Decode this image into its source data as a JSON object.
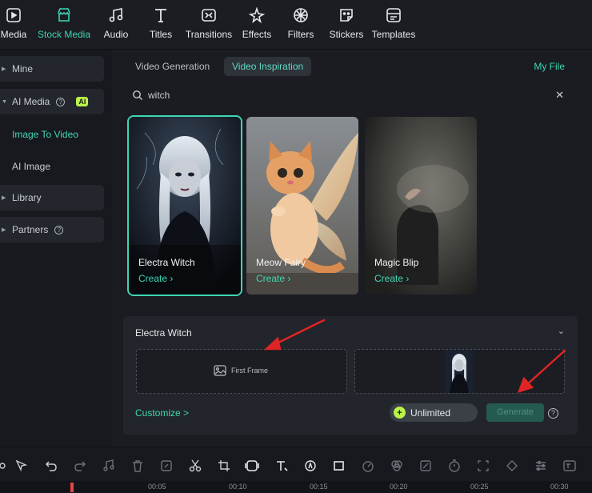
{
  "toolbar": {
    "items": [
      {
        "label": "Media",
        "icon": "media-icon",
        "active": false
      },
      {
        "label": "Stock Media",
        "icon": "stock-media-icon",
        "active": true
      },
      {
        "label": "Audio",
        "icon": "music-note-icon",
        "active": false
      },
      {
        "label": "Titles",
        "icon": "text-t-icon",
        "active": false
      },
      {
        "label": "Transitions",
        "icon": "transition-icon",
        "active": false
      },
      {
        "label": "Effects",
        "icon": "sparkle-star-icon",
        "active": false
      },
      {
        "label": "Filters",
        "icon": "filter-aperture-icon",
        "active": false
      },
      {
        "label": "Stickers",
        "icon": "sticker-icon",
        "active": false
      },
      {
        "label": "Templates",
        "icon": "template-icon",
        "active": false
      }
    ]
  },
  "sidebar": {
    "mine": "Mine",
    "ai_media": "AI Media",
    "ai_badge": "AI",
    "image_to_video": "Image To Video",
    "ai_image": "AI Image",
    "library": "Library",
    "partners": "Partners"
  },
  "tabs": {
    "video_generation": "Video Generation",
    "video_inspiration": "Video Inspiration",
    "active": "Video Inspiration"
  },
  "my_file": "My File",
  "search": {
    "value": "witch"
  },
  "cards": [
    {
      "title": "Electra Witch",
      "action": "Create",
      "selected": true
    },
    {
      "title": "Meow Fairy",
      "action": "Create",
      "selected": false
    },
    {
      "title": "Magic Blip",
      "action": "Create",
      "selected": false
    }
  ],
  "gen_panel": {
    "title": "Electra Witch",
    "first_frame": "First Frame",
    "customize": "Customize >",
    "unlimited": "Unlimited",
    "generate": "Generate"
  },
  "timeline": {
    "ticks": [
      "00:05",
      "00:10",
      "00:15",
      "00:20",
      "00:25",
      "00:30"
    ]
  },
  "colors": {
    "accent": "#3fd6b4",
    "ai_badge": "#b9f34b",
    "annotation_arrow": "#e02424",
    "playhead": "#e4474a"
  }
}
